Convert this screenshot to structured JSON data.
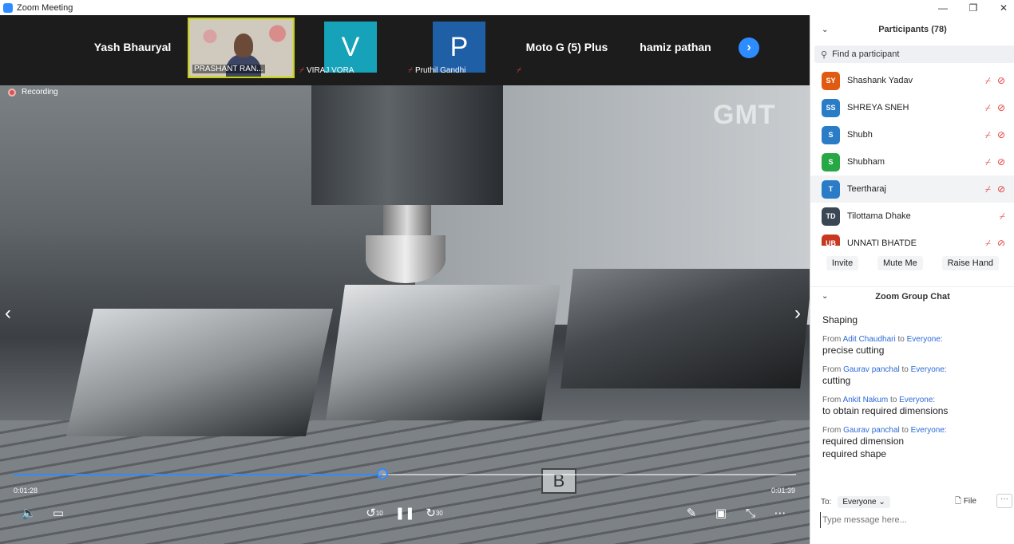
{
  "window": {
    "title": "Zoom Meeting",
    "minimize": "—",
    "restore": "❐",
    "close": "✕"
  },
  "strip": {
    "tiles": [
      {
        "name": "Yash Bhauryal"
      },
      {
        "name": "PRASHANT RAN..."
      },
      {
        "initial": "V",
        "name": "VIRAJ VORA",
        "color": "#16a2b8"
      },
      {
        "initial": "P",
        "name": "Pruthil Gandhi",
        "color": "#1f5fa6"
      },
      {
        "name": "Moto G (5) Plus"
      },
      {
        "name": "hamiz pathan"
      }
    ],
    "next": "›"
  },
  "video": {
    "recording": "Recording",
    "watermark": "GMT",
    "marker": "B",
    "current_time": "0:01:28",
    "total_time": "0:01:39",
    "progress": 0.471,
    "prev": "‹",
    "next": "›"
  },
  "participants": {
    "title": "Participants (78)",
    "search_placeholder": "Find a participant",
    "list": [
      {
        "initials": "SY",
        "name": "Shashank Yadav",
        "color": "#e05a12",
        "cam_off": true
      },
      {
        "initials": "SS",
        "name": "SHREYA SNEH",
        "color": "#2a7cc7",
        "cam_off": true
      },
      {
        "initials": "S",
        "name": "Shubh",
        "color": "#2a7cc7",
        "cam_off": true
      },
      {
        "initials": "S",
        "name": "Shubham",
        "color": "#28a745",
        "cam_off": true
      },
      {
        "initials": "T",
        "name": "Teertharaj",
        "color": "#2a7cc7",
        "cam_off": true
      },
      {
        "initials": "TD",
        "name": "Tilottama Dhake",
        "color": "#3a4654",
        "cam_off": false
      },
      {
        "initials": "UB",
        "name": "UNNATI BHATDE",
        "color": "#c8371f",
        "cam_off": true
      }
    ],
    "buttons": {
      "invite": "Invite",
      "mute": "Mute Me",
      "raise": "Raise Hand"
    }
  },
  "chat": {
    "title": "Zoom Group Chat",
    "messages": [
      {
        "from": "",
        "to": "",
        "text": "Shaping"
      },
      {
        "from": "Adit Chaudhari",
        "to": "Everyone:",
        "text": "precise cutting"
      },
      {
        "from": "Gaurav panchal",
        "to": "Everyone:",
        "text": "cutting"
      },
      {
        "from": "Ankit Nakum",
        "to": "Everyone:",
        "text": " to obtain required dimensions"
      },
      {
        "from": "Gaurav panchal",
        "to": "Everyone:",
        "text": "required dimension",
        "text2": "required shape"
      }
    ],
    "from_word": "From",
    "to_word": "to",
    "to_label": "To:",
    "to_value": "Everyone",
    "file": "File",
    "more": "···",
    "input_placeholder": "Type message here..."
  }
}
